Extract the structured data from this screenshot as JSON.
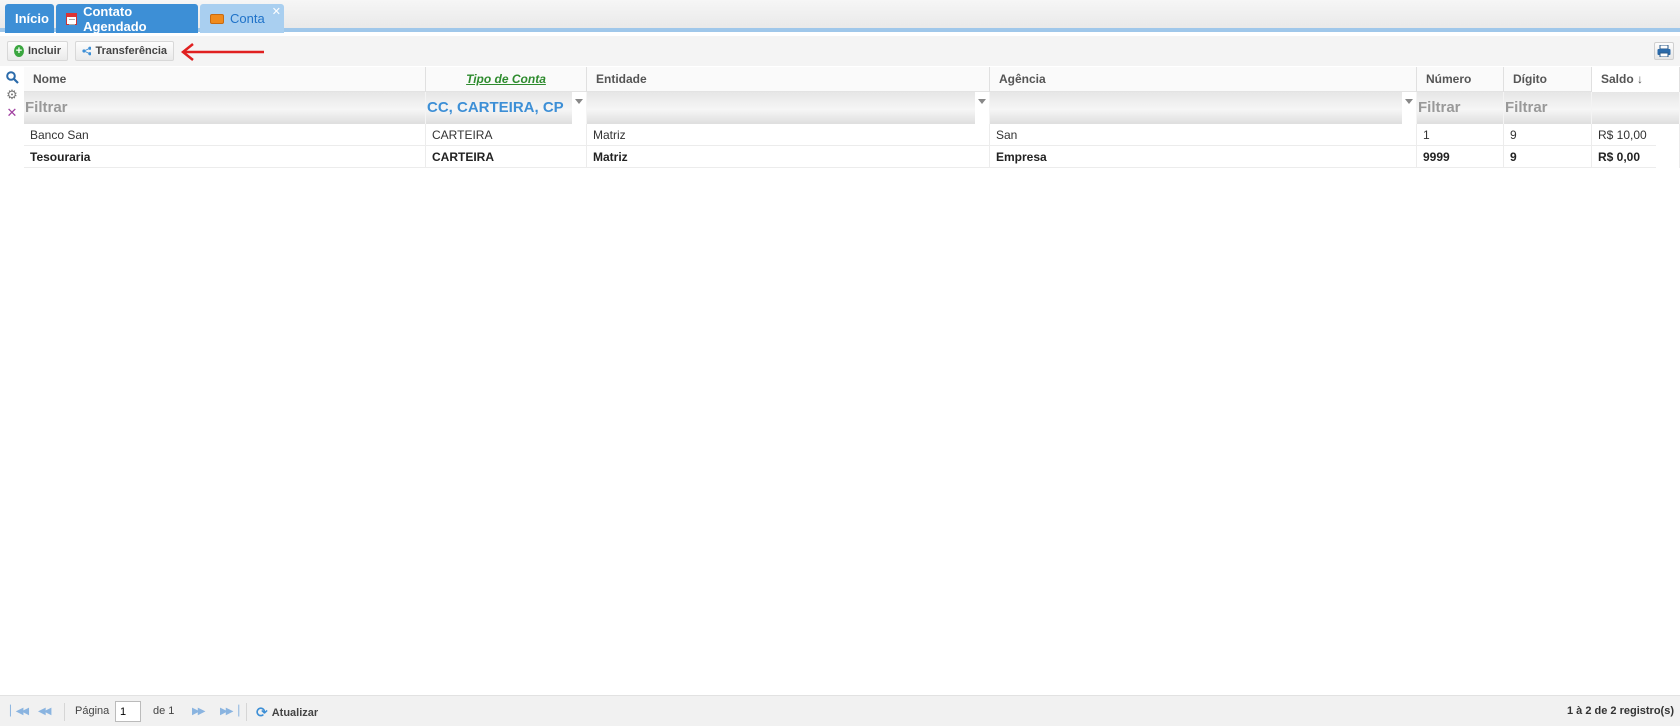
{
  "tabs": [
    {
      "label": "Início"
    },
    {
      "label": "Contato Agendado"
    },
    {
      "label": "Conta"
    }
  ],
  "toolbar": {
    "incluir_label": "Incluir",
    "transferencia_label": "Transferência"
  },
  "grid": {
    "columns": [
      {
        "label": "Nome"
      },
      {
        "label": "Tipo de Conta"
      },
      {
        "label": "Entidade"
      },
      {
        "label": "Agência"
      },
      {
        "label": "Número"
      },
      {
        "label": "Dígito"
      },
      {
        "label": "Saldo ↓"
      }
    ],
    "filters": {
      "nome": "Filtrar",
      "tipo": "CC, CARTEIRA, CP",
      "numero": "Filtrar",
      "digito": "Filtrar"
    },
    "rows": [
      {
        "nome": "Banco San",
        "tipo": "CARTEIRA",
        "entidade": "Matriz",
        "agencia": "San",
        "numero": "1",
        "digito": "9",
        "saldo": "R$ 10,00"
      },
      {
        "nome": "Tesouraria",
        "tipo": "CARTEIRA",
        "entidade": "Matriz",
        "agencia": "Empresa",
        "numero": "9999",
        "digito": "9",
        "saldo": "R$ 0,00"
      }
    ]
  },
  "footer": {
    "page_label": "Página",
    "page_value": "1",
    "of_label": "de 1",
    "refresh_label": "Atualizar",
    "records_label": "1 à 2 de 2 registro(s)"
  },
  "colors": {
    "tab_active": "#3d8fd6",
    "tab_current": "#a9cff0",
    "sorted_header": "#2e8b2e",
    "annotation_arrow": "#e02020"
  }
}
